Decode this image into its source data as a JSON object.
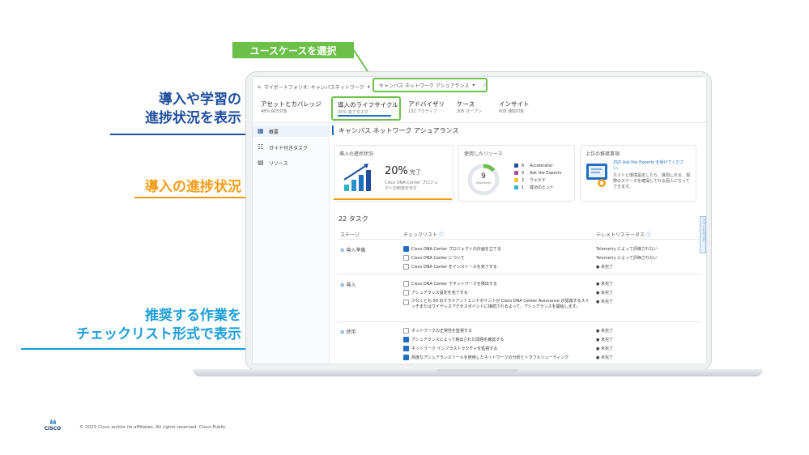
{
  "callouts": {
    "select_use_case": "ユースケースを選択",
    "progress_line1": "導入や学習の",
    "progress_line2": "進捗状況を表示",
    "adoption_progress": "導入の進捗状況",
    "checklist_line1": "推奨する作業を",
    "checklist_line2": "チェックリスト形式で表示"
  },
  "app": {
    "breadcrumb": "マイポートフォリオ: キャンパスネットワーク",
    "use_case_select": "キャンパス ネットワーク アシュアランス",
    "tabs": [
      {
        "label": "アセットとカバレッジ",
        "sub": "48% 保守対象"
      },
      {
        "label": "導入のライフサイクル",
        "sub": "20% 完了タスク"
      },
      {
        "label": "アドバイザリ",
        "sub": "132 アクティブ"
      },
      {
        "label": "ケース",
        "sub": "305 オープン"
      },
      {
        "label": "インサイト",
        "sub": "608 通知対象"
      }
    ],
    "sidebar": [
      {
        "label": "概要"
      },
      {
        "label": "ガイド付きタスク"
      },
      {
        "label": "リソース"
      }
    ],
    "page_title": "キャンパス ネットワーク アシュアランス",
    "progress_card": {
      "title": "導入の進捗状況",
      "percent": "20%",
      "done": "完了",
      "desc1": "Cisco DNA Center プロジェ",
      "desc2": "クトの到達を示す"
    },
    "resources_card": {
      "title": "使用したリソース",
      "total": "9",
      "total_sub": "Resources",
      "items": [
        {
          "count": "6",
          "label": "Accelerator",
          "color": "#1f4e9c"
        },
        {
          "count": "0",
          "label": "Ask the Experts",
          "color": "#b0519e"
        },
        {
          "count": "2",
          "label": "ウェビナ",
          "color": "#f3c33a"
        },
        {
          "count": "1",
          "label": "成功のヒント",
          "color": "#2ab3c9"
        }
      ]
    },
    "recommend_card": {
      "title": "上位の推奨事項",
      "link": "2SD Ask the Experts を受けてください。",
      "text": "ホストと環境設定したら、質問しれる、現際のステータを確保してれる個人になってできます。"
    },
    "tasks": {
      "count_title": "22 タスク",
      "headers": {
        "stage": "ステージ",
        "checklist": "チェックリスト",
        "telemetry": "テレメトリステータス"
      },
      "groups": [
        {
          "stage": "導入準備",
          "items": [
            {
              "text": "Cisco DNA Center プロジェクトの計画を立てる",
              "checked": true,
              "status": "Telemetry によって評価されない"
            },
            {
              "text": "Cisco DNA Center について",
              "checked": false,
              "status": "Telemetry によって評価されない"
            },
            {
              "text": "Cisco DNA Center をインストールを完了する",
              "checked": false,
              "status": "未完了"
            }
          ]
        },
        {
          "stage": "導入",
          "items": [
            {
              "text": "Cisco DNA Center でネットワークを検出する",
              "checked": false,
              "status": "未完了"
            },
            {
              "text": "アシュアランス設定を完了する",
              "checked": false,
              "status": "未完了"
            },
            {
              "text": "少なくとも 50 のクライアントエンドポイントが Cisco DNA Center Assurance が認識するスイッチまたはワイヤレスアクセスポイントに接続されるよって、アシュアランスを開始します。",
              "checked": false,
              "status": "未完了"
            }
          ]
        },
        {
          "stage": "使用",
          "items": [
            {
              "text": "ネットワークの正常性を監視する",
              "checked": false,
              "status": "未完了"
            },
            {
              "text": "アシュアランスによって検出された問題を確認する",
              "checked": true,
              "status": "未完了"
            },
            {
              "text": "ネットワーク インフラストラクチャを監視する",
              "checked": true,
              "status": "未完了"
            },
            {
              "text": "高度なアシュアランスツールを使用したネットワークの分析とトラブルシューティング",
              "checked": true,
              "status": "未完了"
            }
          ]
        }
      ]
    },
    "feedback_tab": "フィードバック"
  },
  "footer": {
    "logo_bars": "ılıılı",
    "logo_text": "CISCO",
    "copyright": "© 2023  Cisco and/or its affiliates. All rights reserved.   Cisco Public"
  },
  "colors": {
    "green": "#6cc04a",
    "blue": "#1f4e9c",
    "orange": "#f39c12",
    "cyan": "#1b9ed9"
  }
}
